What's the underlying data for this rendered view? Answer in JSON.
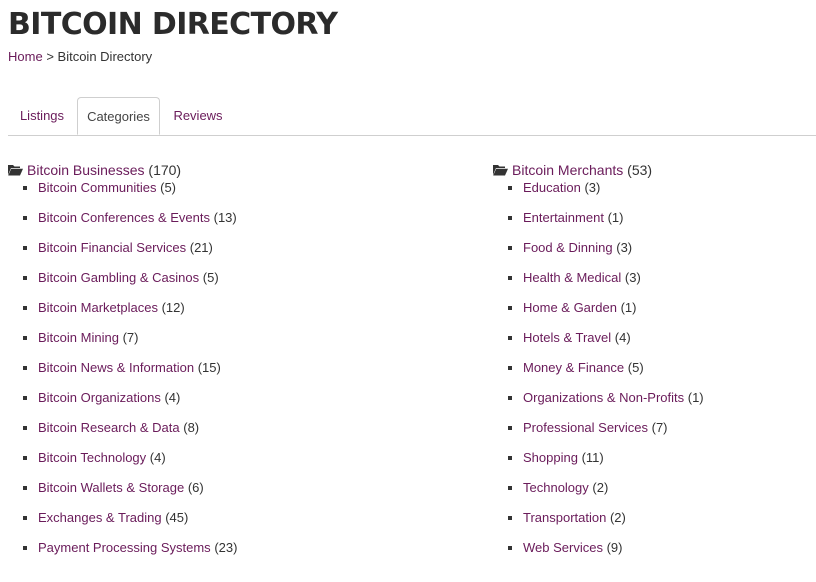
{
  "page": {
    "title": "BITCOIN DIRECTORY",
    "breadcrumb": {
      "home": "Home",
      "separator": ">",
      "current": "Bitcoin Directory"
    }
  },
  "tabs": [
    {
      "label": "Listings",
      "active": false
    },
    {
      "label": "Categories",
      "active": true
    },
    {
      "label": "Reviews",
      "active": false
    }
  ],
  "colors": {
    "link": "#6a1b5a",
    "text": "#333333",
    "title": "#2b2b2b",
    "border": "#cfcfcf"
  },
  "icons": {
    "category": "folder-open-icon",
    "bullet": "square-bullet-icon"
  },
  "categories": [
    {
      "name": "Bitcoin Businesses",
      "count": "(170)",
      "items": [
        {
          "name": "Bitcoin Communities",
          "count": "(5)"
        },
        {
          "name": "Bitcoin Conferences & Events",
          "count": "(13)"
        },
        {
          "name": "Bitcoin Financial Services",
          "count": "(21)"
        },
        {
          "name": "Bitcoin Gambling & Casinos",
          "count": "(5)"
        },
        {
          "name": "Bitcoin Marketplaces",
          "count": "(12)"
        },
        {
          "name": "Bitcoin Mining",
          "count": "(7)"
        },
        {
          "name": "Bitcoin News & Information",
          "count": "(15)"
        },
        {
          "name": "Bitcoin Organizations",
          "count": "(4)"
        },
        {
          "name": "Bitcoin Research & Data",
          "count": "(8)"
        },
        {
          "name": "Bitcoin Technology",
          "count": "(4)"
        },
        {
          "name": "Bitcoin Wallets & Storage",
          "count": "(6)"
        },
        {
          "name": "Exchanges & Trading",
          "count": "(45)"
        },
        {
          "name": "Payment Processing Systems",
          "count": "(23)"
        }
      ]
    },
    {
      "name": "Bitcoin Merchants",
      "count": "(53)",
      "items": [
        {
          "name": "Education",
          "count": "(3)"
        },
        {
          "name": "Entertainment",
          "count": "(1)"
        },
        {
          "name": "Food & Dinning",
          "count": "(3)"
        },
        {
          "name": "Health & Medical",
          "count": "(3)"
        },
        {
          "name": "Home & Garden",
          "count": "(1)"
        },
        {
          "name": "Hotels & Travel",
          "count": "(4)"
        },
        {
          "name": "Money & Finance",
          "count": "(5)"
        },
        {
          "name": "Organizations & Non-Profits",
          "count": "(1)"
        },
        {
          "name": "Professional Services",
          "count": "(7)"
        },
        {
          "name": "Shopping",
          "count": "(11)"
        },
        {
          "name": "Technology",
          "count": "(2)"
        },
        {
          "name": "Transportation",
          "count": "(2)"
        },
        {
          "name": "Web Services",
          "count": "(9)"
        }
      ]
    }
  ]
}
